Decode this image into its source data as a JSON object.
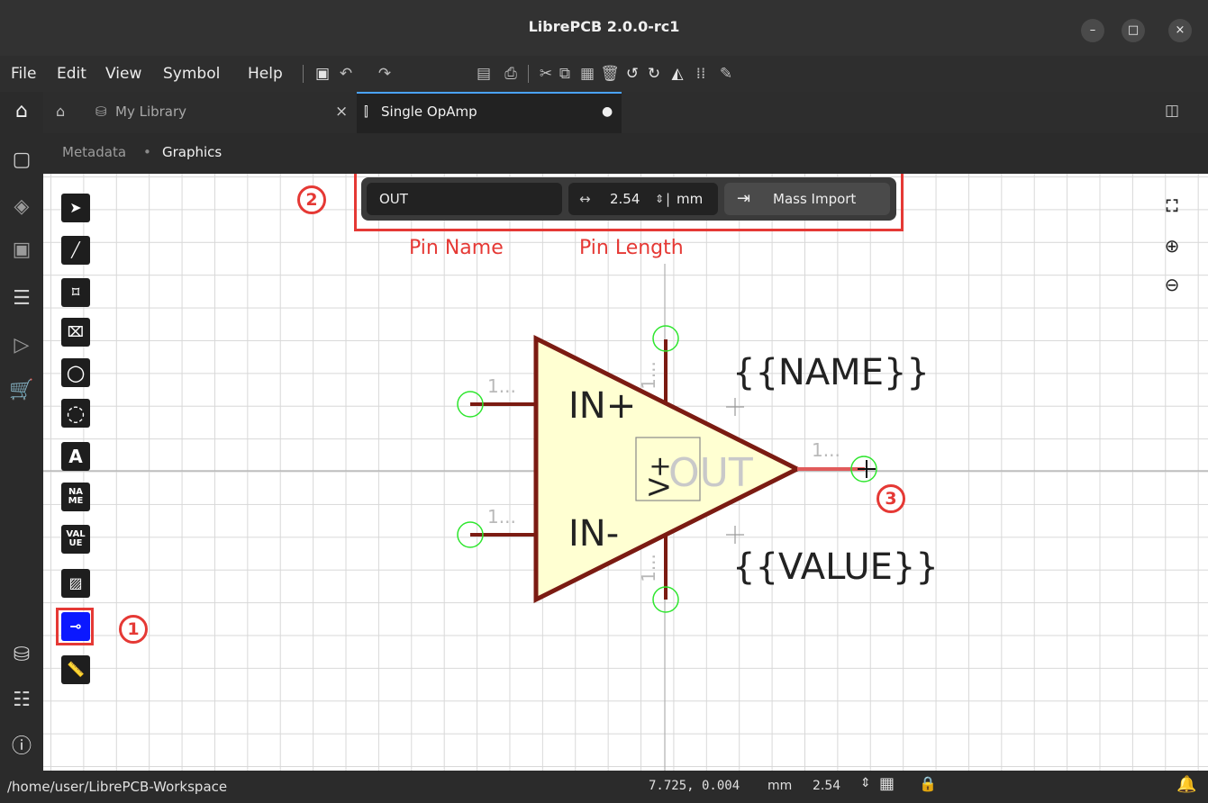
{
  "window": {
    "title": "LibrePCB 2.0.0-rc1"
  },
  "window_controls": {
    "minimize": "–",
    "maximize": "□",
    "close": "×"
  },
  "menu": [
    "File",
    "Edit",
    "View",
    "Symbol",
    "Help"
  ],
  "tabs": [
    {
      "label": "My Library",
      "close": "×"
    },
    {
      "label": "Single OpAmp",
      "modified": "●"
    }
  ],
  "breadcrumb": {
    "items": [
      "Metadata",
      "Graphics"
    ],
    "separator": "•"
  },
  "pin_toolbar": {
    "pin_name_value": "OUT",
    "pin_length_value": "2.54",
    "pin_length_unit": "mm",
    "mass_import_label": "Mass Import"
  },
  "annotations": {
    "marker_1": "1",
    "marker_2": "2",
    "marker_3": "3",
    "pin_name_label": "Pin Name",
    "pin_length_label": "Pin Length",
    "color": "#e53935"
  },
  "symbol": {
    "name_placeholder": "{{NAME}}",
    "value_placeholder": "{{VALUE}}",
    "pin_in_plus": "IN+",
    "pin_in_minus": "IN-",
    "pin_out": "OUT",
    "pin_number_placeholder": "1...",
    "vplus_label": "V+",
    "body_fill": "#ffffd2",
    "outline_color": "#7b1b12"
  },
  "tools": {
    "name_tool": "NA ME",
    "value_tool": "VAL UE"
  },
  "status_bar": {
    "workspace_path": "/home/user/LibrePCB-Workspace",
    "cursor_coords": "7.725, 0.004",
    "unit": "mm",
    "grid_interval": "2.54"
  }
}
